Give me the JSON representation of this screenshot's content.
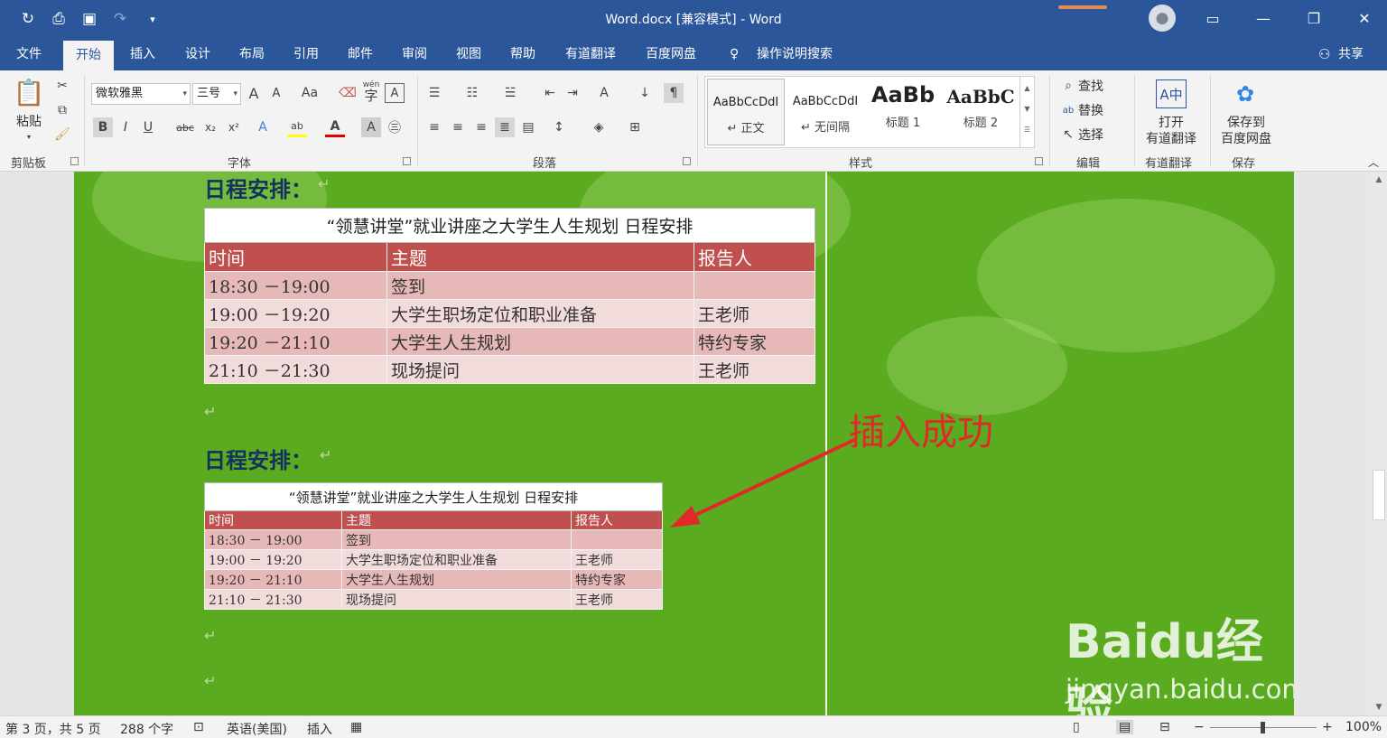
{
  "titlebar": {
    "doc_title": "Word.docx [兼容模式]  -  Word",
    "share": "共享"
  },
  "tabs": [
    "文件",
    "开始",
    "插入",
    "设计",
    "布局",
    "引用",
    "邮件",
    "审阅",
    "视图",
    "帮助",
    "有道翻译",
    "百度网盘",
    "操作说明搜索"
  ],
  "ribbon": {
    "clipboard": {
      "paste": "粘贴",
      "label": "剪贴板"
    },
    "font": {
      "name": "微软雅黑",
      "size": "三号",
      "label": "字体",
      "case": "Aa",
      "wen": "wén"
    },
    "paragraph": {
      "label": "段落"
    },
    "styles": {
      "label": "样式",
      "items": [
        {
          "preview": "AaBbCcDdI",
          "name": "↵ 正文"
        },
        {
          "preview": "AaBbCcDdI",
          "name": "↵ 无间隔"
        },
        {
          "preview": "AaBb",
          "name": "标题 1"
        },
        {
          "preview": "AaBbC",
          "name": "标题 2"
        }
      ]
    },
    "editing": {
      "find": "查找",
      "replace": "替换",
      "select": "选择",
      "label": "编辑"
    },
    "youdao": {
      "line1": "打开",
      "line2": "有道翻译",
      "label": "有道翻译"
    },
    "baidu": {
      "line1": "保存到",
      "line2": "百度网盘",
      "label": "保存"
    }
  },
  "document": {
    "heading": "日程安排：",
    "table_caption": "“领慧讲堂”就业讲座之大学生人生规划 日程安排",
    "table_headers": [
      "时间",
      "主题",
      "报告人"
    ],
    "table1_rows": [
      [
        "18:30 －19:00",
        "签到",
        ""
      ],
      [
        "19:00 －19:20",
        "大学生职场定位和职业准备",
        "王老师"
      ],
      [
        "19:20 －21:10",
        "大学生人生规划",
        "特约专家"
      ],
      [
        "21:10 －21:30",
        "现场提问",
        "王老师"
      ]
    ],
    "table2_rows": [
      [
        "18:30 － 19:00",
        "签到",
        ""
      ],
      [
        "19:00 － 19:20",
        "大学生职场定位和职业准备",
        "王老师"
      ],
      [
        "19:20 － 21:10",
        "大学生人生规划",
        "特约专家"
      ],
      [
        "21:10 － 21:30",
        "现场提问",
        "王老师"
      ]
    ],
    "annotation": "插入成功",
    "watermark_logo": "Baidu经验",
    "watermark_url": "jingyan.baidu.com"
  },
  "statusbar": {
    "page": "第 3 页，共 5 页",
    "words": "288 个字",
    "language": "英语(美国)",
    "mode": "插入",
    "zoom": "100%"
  },
  "colors": {
    "brand": "#2b579a",
    "table_header": "#c0504d",
    "row_dark": "#e6b8b7",
    "row_light": "#f2dcdb",
    "annotation": "#e22929",
    "page_bg": "#5aab1f"
  }
}
